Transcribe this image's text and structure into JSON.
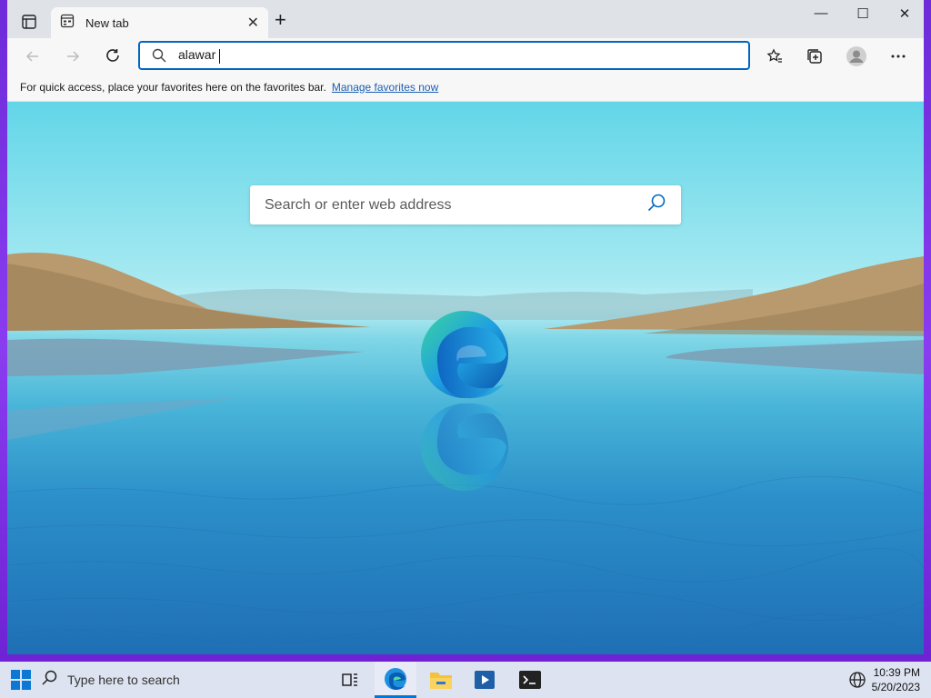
{
  "tab": {
    "title": "New tab"
  },
  "address_bar": {
    "value": "alawar"
  },
  "favorites_bar": {
    "message": "For quick access, place your favorites here on the favorites bar.",
    "link": "Manage favorites now"
  },
  "page": {
    "search_placeholder": "Search or enter web address"
  },
  "taskbar": {
    "search_label": "Type here to search",
    "time": "10:39 PM",
    "date": "5/20/2023"
  },
  "colors": {
    "accent": "#0067c0",
    "link": "#1a5fb4"
  }
}
